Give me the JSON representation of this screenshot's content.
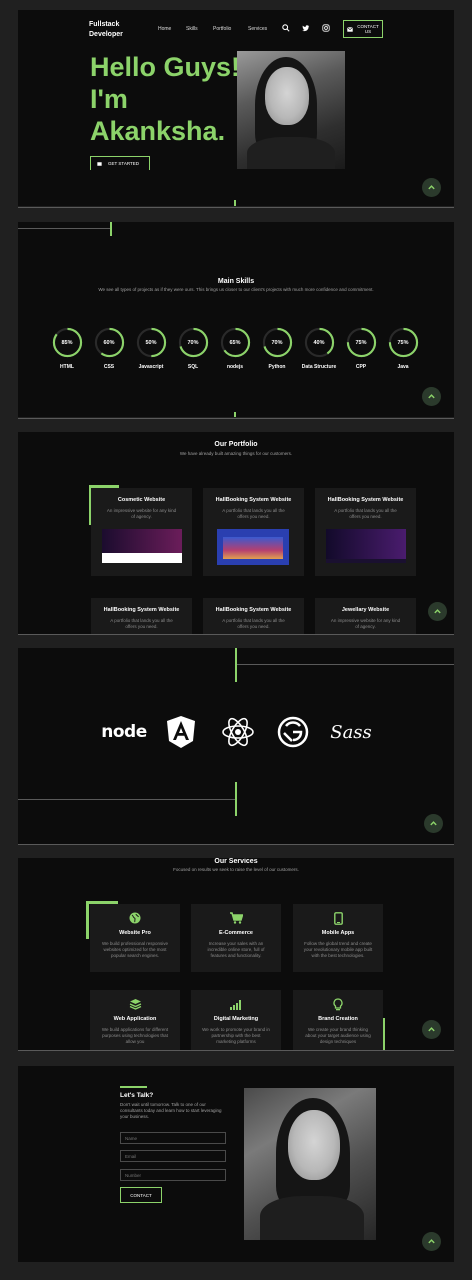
{
  "colors": {
    "accent": "#8cd36a",
    "panel": "#0c0c0c",
    "page": "#202020",
    "card": "#1a1a1a"
  },
  "header": {
    "brand_line1": "Fullstack",
    "brand_line2": "Developer",
    "nav": [
      "Home",
      "Skills",
      "Portfolio",
      "Services"
    ],
    "icons": [
      "search-icon",
      "twitter-icon",
      "instagram-icon"
    ],
    "contact_line1": "CONTACT",
    "contact_line2": "US"
  },
  "hero": {
    "line1": "Hello Guys!",
    "line2": "I'm",
    "line3": "Akanksha.",
    "cta": "GET STARTED"
  },
  "skills": {
    "title": "Main Skills",
    "subtitle": "We see all types of projects as if they were ours. This brings us closer to our client's projects with much more confidence and commitment.",
    "items": [
      {
        "name": "HTML",
        "percent": 85
      },
      {
        "name": "CSS",
        "percent": 60
      },
      {
        "name": "Javascript",
        "percent": 50
      },
      {
        "name": "SQL",
        "percent": 70
      },
      {
        "name": "nodejs",
        "percent": 65
      },
      {
        "name": "Python",
        "percent": 70
      },
      {
        "name": "Data Structure",
        "percent": 40
      },
      {
        "name": "CPP",
        "percent": 75
      },
      {
        "name": "Java",
        "percent": 75
      }
    ]
  },
  "portfolio": {
    "title": "Our Portfolio",
    "subtitle": "We have already built amazing things for our customers.",
    "items": [
      {
        "title": "Cosmetic Website",
        "desc": "An impressive website for any kind of agency."
      },
      {
        "title": "HallBooking System Website",
        "desc": "A portfolio that lands you all the offers you need."
      },
      {
        "title": "HallBooking System Website",
        "desc": "A portfolio that lands you all the offers you need."
      },
      {
        "title": "HallBooking System Website",
        "desc": "A portfolio that lands you all the offers you need."
      },
      {
        "title": "HallBooking System Website",
        "desc": "A portfolio that lands you all the offers you need."
      },
      {
        "title": "Jewellary Website",
        "desc": "An impressive website for any kind of agency."
      }
    ]
  },
  "logos": {
    "items": [
      "node",
      "angular",
      "react",
      "gatsby",
      "Sass"
    ]
  },
  "services": {
    "title": "Our Services",
    "subtitle": "Focused on results we seek to raise the level of our customers.",
    "items": [
      {
        "title": "Website Pro",
        "desc": "We build professional responsive websites optimized for the most popular search engines.",
        "icon": "globe-icon"
      },
      {
        "title": "E-Commerce",
        "desc": "Increase your sales with an incredible online store, full of features and functionality.",
        "icon": "cart-icon"
      },
      {
        "title": "Mobile Apps",
        "desc": "Follow the global trend and create your revolutionary mobile app built with the best technologies.",
        "icon": "phone-icon"
      },
      {
        "title": "Web Application",
        "desc": "We build applications for different purposes using technologies that allow you",
        "icon": "layers-icon"
      },
      {
        "title": "Digital Marketing",
        "desc": "We work to promote your brand in partnership with the best marketing platforms",
        "icon": "signal-icon"
      },
      {
        "title": "Brand Creation",
        "desc": "We create your brand thinking about your target audience using design techniques",
        "icon": "bulb-icon"
      }
    ]
  },
  "contact": {
    "title": "Let's Talk?",
    "desc": "Don't wait until tomorrow. Talk to one of our consultants today and learn how to start leveraging your business.",
    "name_placeholder": "Name",
    "email_placeholder": "Email",
    "number_placeholder": "Number",
    "button": "CONTACT"
  }
}
